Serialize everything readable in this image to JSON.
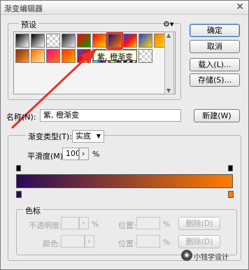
{
  "window": {
    "title": "渐变编辑器",
    "close_glyph": "✕"
  },
  "presets": {
    "label": "预设",
    "gear_glyph": "⚙▾",
    "tooltip": "紫, 橙渐变"
  },
  "buttons": {
    "ok": "确定",
    "cancel": "取消",
    "load": "载入(L)...",
    "save": "存储(S)...",
    "new": "新建(W)"
  },
  "name": {
    "label": "名称(N):",
    "value": "紫, 橙渐变"
  },
  "gradient_type": {
    "label": "渐变类型(T):",
    "value": "实底"
  },
  "smoothness": {
    "label": "平滑度(M):",
    "value": "100",
    "unit": "%",
    "arrow": "›"
  },
  "color_stops": {
    "group_label": "色标",
    "opacity_label": "不透明度:",
    "opacity_unit": "%",
    "color_label": "颜色:",
    "location_label": "位置:",
    "location_unit": "%",
    "delete_label": "删除(D)",
    "arrow": "›"
  },
  "colors": {
    "gradient_start": "#290a59",
    "gradient_end": "#ff7c00",
    "annotation_arrow": "#e8322a"
  },
  "watermark": {
    "text": "小钱学设计"
  }
}
